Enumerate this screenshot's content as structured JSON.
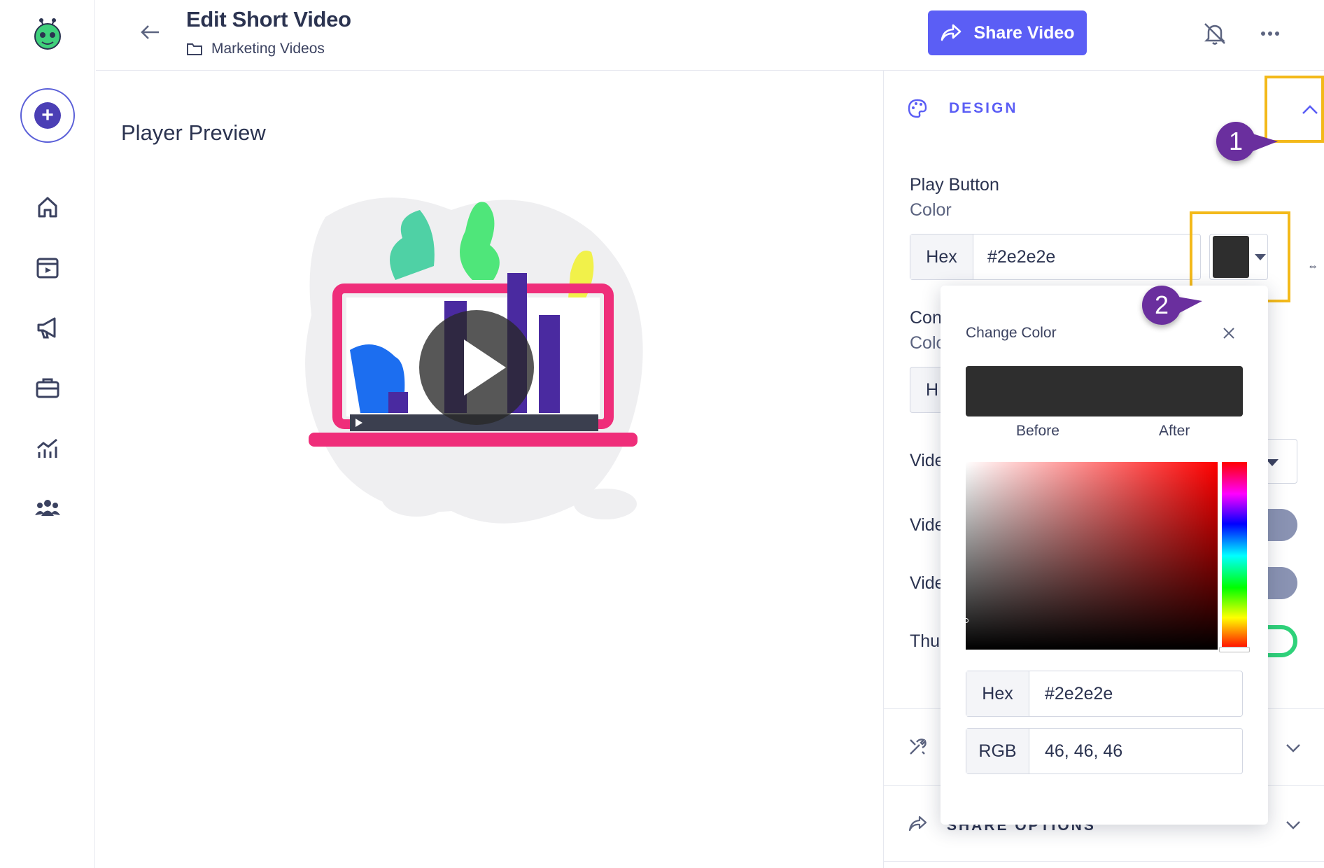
{
  "header": {
    "title": "Edit Short Video",
    "folder": "Marketing Videos",
    "share_label": "Share Video"
  },
  "main": {
    "preview_title": "Player Preview"
  },
  "panel": {
    "design_label": "DESIGN",
    "play_button_label": "Play Button",
    "color_label": "Color",
    "hex_addon": "Hex",
    "hex_value": "#2e2e2e",
    "cut_labels": [
      "Con",
      "Colo",
      "H",
      "Vide",
      "Vide",
      "Vide",
      "Thu"
    ],
    "share_options_label": "SHARE OPTIONS"
  },
  "callouts": [
    "1",
    "2"
  ],
  "color_picker": {
    "title": "Change Color",
    "before_label": "Before",
    "after_label": "After",
    "before_color": "#2e2e2e",
    "after_color": "#2e2e2e",
    "hex_label": "Hex",
    "hex_value": "#2e2e2e",
    "rgb_label": "RGB",
    "rgb_value": "46, 46, 46"
  },
  "colors": {
    "accent": "#5b5ef5",
    "highlight": "#f3b91a",
    "callout": "#6a2f9e",
    "toggle_on": "#2fd27a"
  }
}
